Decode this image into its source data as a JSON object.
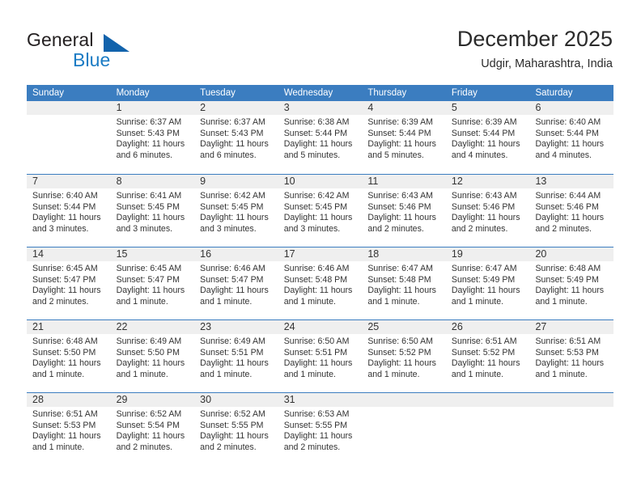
{
  "brand": {
    "word1": "General",
    "word2": "Blue",
    "triangle_color": "#1263ac",
    "blue_color": "#1a7bc4"
  },
  "header": {
    "title": "December 2025",
    "subtitle": "Udgir, Maharashtra, India"
  },
  "theme": {
    "header_blue": "#3b7dc0",
    "date_strip_gray": "#efefef",
    "text_color": "#333333"
  },
  "weekdays": [
    "Sunday",
    "Monday",
    "Tuesday",
    "Wednesday",
    "Thursday",
    "Friday",
    "Saturday"
  ],
  "weeks": [
    [
      {
        "day": "",
        "sunrise": "",
        "sunset": "",
        "daylight": "",
        "daylight2": ""
      },
      {
        "day": "1",
        "sunrise": "Sunrise: 6:37 AM",
        "sunset": "Sunset: 5:43 PM",
        "daylight": "Daylight: 11 hours",
        "daylight2": "and 6 minutes."
      },
      {
        "day": "2",
        "sunrise": "Sunrise: 6:37 AM",
        "sunset": "Sunset: 5:43 PM",
        "daylight": "Daylight: 11 hours",
        "daylight2": "and 6 minutes."
      },
      {
        "day": "3",
        "sunrise": "Sunrise: 6:38 AM",
        "sunset": "Sunset: 5:44 PM",
        "daylight": "Daylight: 11 hours",
        "daylight2": "and 5 minutes."
      },
      {
        "day": "4",
        "sunrise": "Sunrise: 6:39 AM",
        "sunset": "Sunset: 5:44 PM",
        "daylight": "Daylight: 11 hours",
        "daylight2": "and 5 minutes."
      },
      {
        "day": "5",
        "sunrise": "Sunrise: 6:39 AM",
        "sunset": "Sunset: 5:44 PM",
        "daylight": "Daylight: 11 hours",
        "daylight2": "and 4 minutes."
      },
      {
        "day": "6",
        "sunrise": "Sunrise: 6:40 AM",
        "sunset": "Sunset: 5:44 PM",
        "daylight": "Daylight: 11 hours",
        "daylight2": "and 4 minutes."
      }
    ],
    [
      {
        "day": "7",
        "sunrise": "Sunrise: 6:40 AM",
        "sunset": "Sunset: 5:44 PM",
        "daylight": "Daylight: 11 hours",
        "daylight2": "and 3 minutes."
      },
      {
        "day": "8",
        "sunrise": "Sunrise: 6:41 AM",
        "sunset": "Sunset: 5:45 PM",
        "daylight": "Daylight: 11 hours",
        "daylight2": "and 3 minutes."
      },
      {
        "day": "9",
        "sunrise": "Sunrise: 6:42 AM",
        "sunset": "Sunset: 5:45 PM",
        "daylight": "Daylight: 11 hours",
        "daylight2": "and 3 minutes."
      },
      {
        "day": "10",
        "sunrise": "Sunrise: 6:42 AM",
        "sunset": "Sunset: 5:45 PM",
        "daylight": "Daylight: 11 hours",
        "daylight2": "and 3 minutes."
      },
      {
        "day": "11",
        "sunrise": "Sunrise: 6:43 AM",
        "sunset": "Sunset: 5:46 PM",
        "daylight": "Daylight: 11 hours",
        "daylight2": "and 2 minutes."
      },
      {
        "day": "12",
        "sunrise": "Sunrise: 6:43 AM",
        "sunset": "Sunset: 5:46 PM",
        "daylight": "Daylight: 11 hours",
        "daylight2": "and 2 minutes."
      },
      {
        "day": "13",
        "sunrise": "Sunrise: 6:44 AM",
        "sunset": "Sunset: 5:46 PM",
        "daylight": "Daylight: 11 hours",
        "daylight2": "and 2 minutes."
      }
    ],
    [
      {
        "day": "14",
        "sunrise": "Sunrise: 6:45 AM",
        "sunset": "Sunset: 5:47 PM",
        "daylight": "Daylight: 11 hours",
        "daylight2": "and 2 minutes."
      },
      {
        "day": "15",
        "sunrise": "Sunrise: 6:45 AM",
        "sunset": "Sunset: 5:47 PM",
        "daylight": "Daylight: 11 hours",
        "daylight2": "and 1 minute."
      },
      {
        "day": "16",
        "sunrise": "Sunrise: 6:46 AM",
        "sunset": "Sunset: 5:47 PM",
        "daylight": "Daylight: 11 hours",
        "daylight2": "and 1 minute."
      },
      {
        "day": "17",
        "sunrise": "Sunrise: 6:46 AM",
        "sunset": "Sunset: 5:48 PM",
        "daylight": "Daylight: 11 hours",
        "daylight2": "and 1 minute."
      },
      {
        "day": "18",
        "sunrise": "Sunrise: 6:47 AM",
        "sunset": "Sunset: 5:48 PM",
        "daylight": "Daylight: 11 hours",
        "daylight2": "and 1 minute."
      },
      {
        "day": "19",
        "sunrise": "Sunrise: 6:47 AM",
        "sunset": "Sunset: 5:49 PM",
        "daylight": "Daylight: 11 hours",
        "daylight2": "and 1 minute."
      },
      {
        "day": "20",
        "sunrise": "Sunrise: 6:48 AM",
        "sunset": "Sunset: 5:49 PM",
        "daylight": "Daylight: 11 hours",
        "daylight2": "and 1 minute."
      }
    ],
    [
      {
        "day": "21",
        "sunrise": "Sunrise: 6:48 AM",
        "sunset": "Sunset: 5:50 PM",
        "daylight": "Daylight: 11 hours",
        "daylight2": "and 1 minute."
      },
      {
        "day": "22",
        "sunrise": "Sunrise: 6:49 AM",
        "sunset": "Sunset: 5:50 PM",
        "daylight": "Daylight: 11 hours",
        "daylight2": "and 1 minute."
      },
      {
        "day": "23",
        "sunrise": "Sunrise: 6:49 AM",
        "sunset": "Sunset: 5:51 PM",
        "daylight": "Daylight: 11 hours",
        "daylight2": "and 1 minute."
      },
      {
        "day": "24",
        "sunrise": "Sunrise: 6:50 AM",
        "sunset": "Sunset: 5:51 PM",
        "daylight": "Daylight: 11 hours",
        "daylight2": "and 1 minute."
      },
      {
        "day": "25",
        "sunrise": "Sunrise: 6:50 AM",
        "sunset": "Sunset: 5:52 PM",
        "daylight": "Daylight: 11 hours",
        "daylight2": "and 1 minute."
      },
      {
        "day": "26",
        "sunrise": "Sunrise: 6:51 AM",
        "sunset": "Sunset: 5:52 PM",
        "daylight": "Daylight: 11 hours",
        "daylight2": "and 1 minute."
      },
      {
        "day": "27",
        "sunrise": "Sunrise: 6:51 AM",
        "sunset": "Sunset: 5:53 PM",
        "daylight": "Daylight: 11 hours",
        "daylight2": "and 1 minute."
      }
    ],
    [
      {
        "day": "28",
        "sunrise": "Sunrise: 6:51 AM",
        "sunset": "Sunset: 5:53 PM",
        "daylight": "Daylight: 11 hours",
        "daylight2": "and 1 minute."
      },
      {
        "day": "29",
        "sunrise": "Sunrise: 6:52 AM",
        "sunset": "Sunset: 5:54 PM",
        "daylight": "Daylight: 11 hours",
        "daylight2": "and 2 minutes."
      },
      {
        "day": "30",
        "sunrise": "Sunrise: 6:52 AM",
        "sunset": "Sunset: 5:55 PM",
        "daylight": "Daylight: 11 hours",
        "daylight2": "and 2 minutes."
      },
      {
        "day": "31",
        "sunrise": "Sunrise: 6:53 AM",
        "sunset": "Sunset: 5:55 PM",
        "daylight": "Daylight: 11 hours",
        "daylight2": "and 2 minutes."
      },
      {
        "day": "",
        "sunrise": "",
        "sunset": "",
        "daylight": "",
        "daylight2": ""
      },
      {
        "day": "",
        "sunrise": "",
        "sunset": "",
        "daylight": "",
        "daylight2": ""
      },
      {
        "day": "",
        "sunrise": "",
        "sunset": "",
        "daylight": "",
        "daylight2": ""
      }
    ]
  ]
}
